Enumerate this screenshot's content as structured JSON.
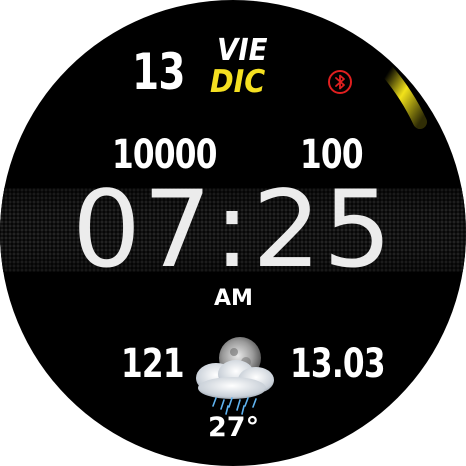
{
  "date": {
    "day": "13",
    "weekday": "VIE",
    "month": "DIC"
  },
  "stats": {
    "steps": "10000",
    "battery": "100",
    "heart_rate": "121",
    "pressure": "13.03"
  },
  "time": {
    "display": "07:25",
    "period": "AM"
  },
  "weather": {
    "icon": "night-rain-cloud-icon",
    "temperature": "27°"
  },
  "status": {
    "bluetooth_icon": "bluetooth-icon",
    "bluetooth_color": "#e01f1f"
  },
  "colors": {
    "background": "#000000",
    "month_accent": "#f5e021",
    "arc_accent": "#f2e21a",
    "text": "#ffffff"
  }
}
